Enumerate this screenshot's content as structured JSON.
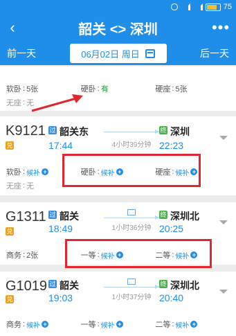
{
  "status_bar": {
    "time": "10:26",
    "battery": "75"
  },
  "header": {
    "back_icon": "chevron-left",
    "title": "韶关 <> 深圳",
    "more_icon": "more-dots"
  },
  "date_bar": {
    "prev_label": "前一天",
    "date": "06月02日 周日",
    "next_label": "后一天"
  },
  "card0": {
    "row1": [
      {
        "name": "软卧",
        "count": "5张"
      },
      {
        "name": "硬卧",
        "count": "有"
      },
      {
        "name": "硬座",
        "count": "5张"
      }
    ],
    "row2": [
      {
        "name": "无座",
        "count": "无"
      }
    ]
  },
  "trains": [
    {
      "number": "K9121",
      "tag": "兑",
      "from_tag": "过",
      "from": "韶关东",
      "depart": "17:44",
      "duration": "4小时39分钟",
      "to_tag": "终",
      "to": "深圳",
      "arrive": "22:23",
      "seats_row1": [
        {
          "name": "软卧",
          "status": "候补"
        },
        {
          "name": "硬卧",
          "status": "候补"
        },
        {
          "name": "硬座",
          "status": "候补"
        }
      ],
      "seats_row2": [
        {
          "name": "无座",
          "status": "无"
        }
      ]
    },
    {
      "number": "G1311",
      "tag": "兑",
      "from_tag": "过",
      "from": "韶关",
      "depart": "18:49",
      "duration": "1小时36分钟",
      "to_tag": "终",
      "to": "深圳北",
      "arrive": "20:25",
      "seats_row1": [
        {
          "name": "商务",
          "status": "2张"
        },
        {
          "name": "一等",
          "status": "候补"
        },
        {
          "name": "二等",
          "status": "候补"
        }
      ]
    },
    {
      "number": "G1019",
      "tag": "兑",
      "from_tag": "过",
      "from": "韶关",
      "depart": "19:03",
      "duration": "1小时37分钟",
      "to_tag": "终",
      "to": "深圳北",
      "arrive": "20:40",
      "seats_row1": [
        {
          "name": "商务",
          "status": "候补"
        },
        {
          "name": "一等",
          "status": "候补"
        },
        {
          "name": "二等",
          "status": "候补"
        }
      ]
    }
  ],
  "colors": {
    "primary": "#1f8ee9",
    "available": "#2a9d3e",
    "highlight": "#e0262e"
  }
}
